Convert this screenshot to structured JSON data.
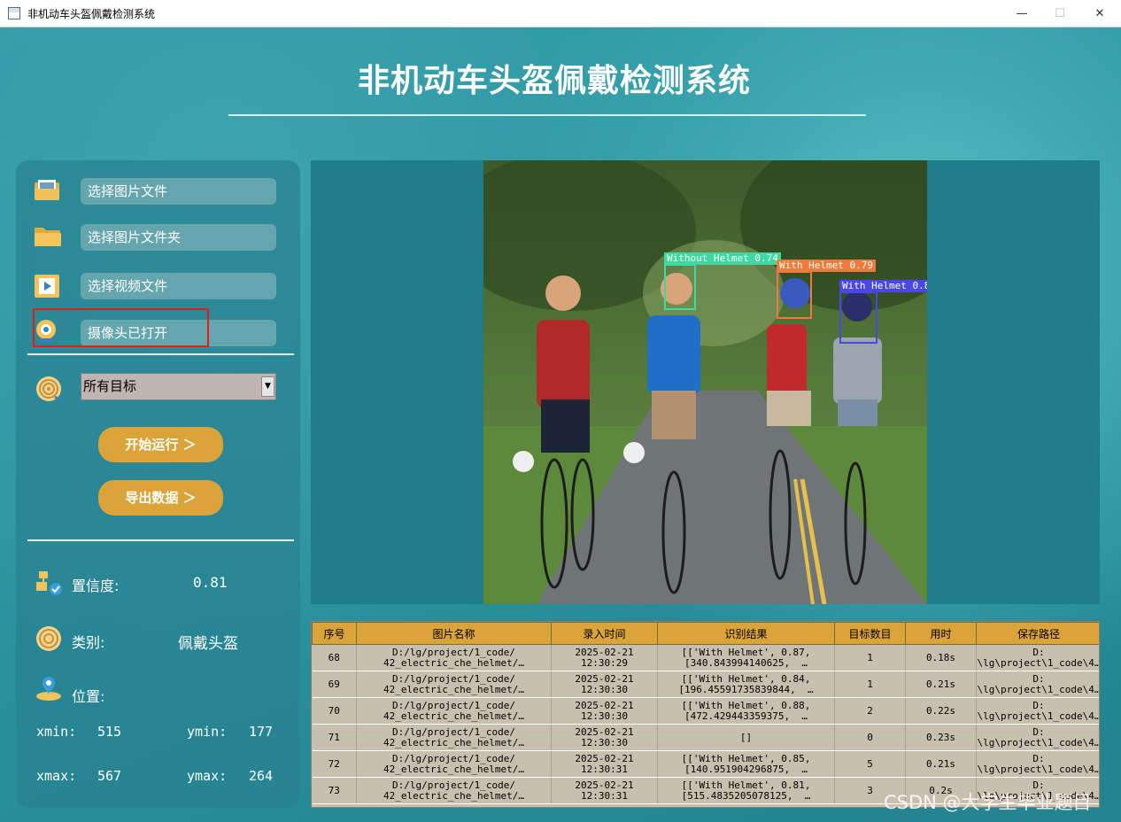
{
  "window": {
    "title": "非机动车头盔佩戴检测系统",
    "minimize": "—",
    "maximize": "☐",
    "close": "✕"
  },
  "header": {
    "title": "非机动车头盔佩戴检测系统"
  },
  "sidebar": {
    "buttons": [
      {
        "label": "选择图片文件",
        "icon": "image-file-icon"
      },
      {
        "label": "选择图片文件夹",
        "icon": "folder-icon"
      },
      {
        "label": "选择视频文件",
        "icon": "video-file-icon"
      },
      {
        "label": "摄像头已打开",
        "icon": "camera-icon"
      }
    ],
    "target_select": {
      "value": "所有目标",
      "arrow": "▼"
    },
    "run_button": "开始运行 ＞",
    "export_button": "导出数据 ＞",
    "confidence_label": "置信度:",
    "confidence_value": "0.81",
    "class_label": "类别:",
    "class_value": "佩戴头盔",
    "position_label": "位置:",
    "xmin_label": "xmin:",
    "xmin_value": "515",
    "ymin_label": "ymin:",
    "ymin_value": "177",
    "xmax_label": "xmax:",
    "xmax_value": "567",
    "ymax_label": "ymax:",
    "ymax_value": "264"
  },
  "detections": [
    {
      "label": "Without Helmet 0.74",
      "color": "#3dd9a0"
    },
    {
      "label": "With Helmet 0.79",
      "color": "#f07a3a"
    },
    {
      "label": "With Helmet 0.8",
      "color": "#4a46e8"
    }
  ],
  "table": {
    "headers": [
      "序号",
      "图片名称",
      "录入时间",
      "识别结果",
      "目标数目",
      "用时",
      "保存路径"
    ],
    "rows": [
      [
        "68",
        "D:/lg/project/1_code/\n42_electric_che_helmet/…",
        "2025-02-21\n12:30:29",
        "[['With Helmet', 0.87,\n[340.843994140625,  …",
        "1",
        "0.18s",
        "D:\n\\lg\\project\\1_code\\4…"
      ],
      [
        "69",
        "D:/lg/project/1_code/\n42_electric_che_helmet/…",
        "2025-02-21\n12:30:30",
        "[['With Helmet', 0.84,\n[196.45591735839844,  …",
        "1",
        "0.21s",
        "D:\n\\lg\\project\\1_code\\4…"
      ],
      [
        "70",
        "D:/lg/project/1_code/\n42_electric_che_helmet/…",
        "2025-02-21\n12:30:30",
        "[['With Helmet', 0.88,\n[472.429443359375,  …",
        "2",
        "0.22s",
        "D:\n\\lg\\project\\1_code\\4…"
      ],
      [
        "71",
        "D:/lg/project/1_code/\n42_electric_che_helmet/…",
        "2025-02-21\n12:30:30",
        "[]",
        "0",
        "0.23s",
        "D:\n\\lg\\project\\1_code\\4…"
      ],
      [
        "72",
        "D:/lg/project/1_code/\n42_electric_che_helmet/…",
        "2025-02-21\n12:30:31",
        "[['With Helmet', 0.85,\n[140.951904296875,  …",
        "5",
        "0.21s",
        "D:\n\\lg\\project\\1_code\\4…"
      ],
      [
        "73",
        "D:/lg/project/1_code/\n42_electric_che_helmet/…",
        "2025-02-21\n12:30:31",
        "[['With Helmet', 0.81,\n[515.4835205078125,  …",
        "3",
        "0.2s",
        "D:\n\\lg\\project\\1_code\\4…"
      ]
    ]
  },
  "watermark": "CSDN @大学生毕业题目"
}
